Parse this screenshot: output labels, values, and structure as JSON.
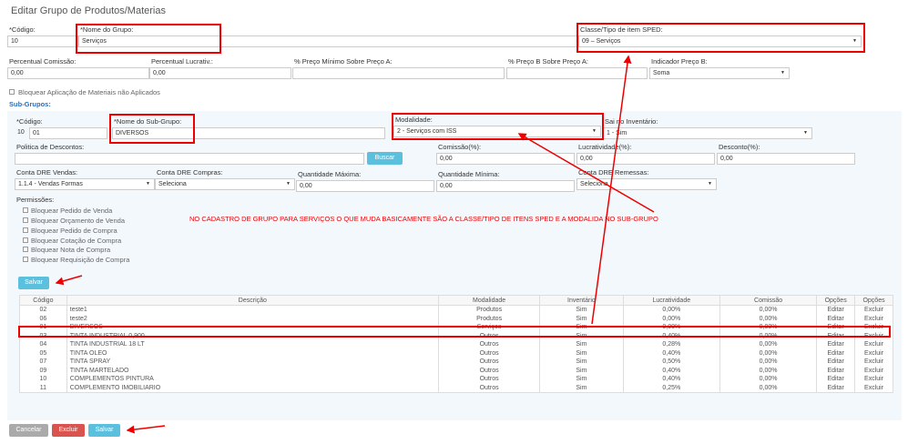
{
  "page": {
    "title": "Editar Grupo de Produtos/Materias"
  },
  "group": {
    "codigo_label": "*Código:",
    "codigo": "10",
    "nome_label": "*Nome do Grupo:",
    "nome": "Serviços",
    "classe_label": "Classe/Tipo de item SPED:",
    "classe": "09 – Serviços",
    "comissao_label": "Percentual Comissão:",
    "comissao": "0,00",
    "lucrativ_label": "Percentual Lucrativ.:",
    "lucrativ": "0,00",
    "precoA_label": "% Preço Mínimo Sobre Preço A:",
    "precoA": "",
    "precoB_label": "% Preço B Sobre Preço A:",
    "precoB": "",
    "indicador_label": "Indicador Preço B:",
    "indicador": "Soma",
    "bloquear_label": "Bloquear Aplicação de Materiais não Aplicados"
  },
  "sub": {
    "section_label": "Sub-Grupos:",
    "codigo_label": "*Código:",
    "codigo_grupo": "10",
    "codigo": "01",
    "nome_label": "*Nome do Sub-Grupo:",
    "nome": "DIVERSOS",
    "modalidade_label": "Modalidade:",
    "modalidade": "2 - Serviços com ISS",
    "inventario_label": "Sai no Inventário:",
    "inventario": "1 - Sim",
    "politica_label": "Politica de Descontos:",
    "politica": "",
    "buscar": "Buscar",
    "comissao_label": "Comissão(%):",
    "comissao": "0,00",
    "lucratividade_label": "Lucratividade(%):",
    "lucratividade": "0,00",
    "desconto_label": "Desconto(%):",
    "desconto": "0,00",
    "dre_vendas_label": "Conta DRE Vendas:",
    "dre_vendas": "1.1.4 - Vendas Formas",
    "dre_compras_label": "Conta DRE Compras:",
    "dre_compras": "Seleciona",
    "qtd_max_label": "Quantidade Máxima:",
    "qtd_max": "0,00",
    "qtd_min_label": "Quantidade Mínima:",
    "qtd_min": "0,00",
    "dre_remessas_label": "Conta DRE Remessas:",
    "dre_remessas": "Seleciona",
    "permissoes_label": "Permissões:",
    "permissoes": [
      "Bloquear Pedido de Venda",
      "Bloquear Orçamento de Venda",
      "Bloquear Pedido de Compra",
      "Bloquear Cotação de Compra",
      "Bloquear Nota de Compra",
      "Bloquear Requisição de Compra"
    ],
    "salvar": "Salvar"
  },
  "annotation": "NO CADASTRO DE GRUPO PARA SERVIÇOS O QUE MUDA BASICAMENTE SÃO A CLASSE/TIPO DE ITENS SPED E A MODALIDA NO SUB-GRUPO",
  "table": {
    "headers": [
      "Código",
      "Descrição",
      "Modalidade",
      "Inventário",
      "Lucratividade",
      "Comissão",
      "Opções",
      "Opções"
    ],
    "rows": [
      [
        "02",
        "teste1",
        "Produtos",
        "Sim",
        "0,00%",
        "0,00%",
        "Editar",
        "Excluir"
      ],
      [
        "06",
        "teste2",
        "Produtos",
        "Sim",
        "0,00%",
        "0,00%",
        "Editar",
        "Excluir"
      ],
      [
        "01",
        "DIVERSOS",
        "Serviços",
        "Sim",
        "0,00%",
        "0,00%",
        "Editar",
        "Excluir"
      ],
      [
        "03",
        "TINTA INDUSTRIAL 0,900",
        "Outros",
        "Sim",
        "0,40%",
        "0,00%",
        "Editar",
        "Excluir"
      ],
      [
        "04",
        "TINTA INDUSTRIAL 18 LT",
        "Outros",
        "Sim",
        "0,28%",
        "0,00%",
        "Editar",
        "Excluir"
      ],
      [
        "05",
        "TINTA OLEO",
        "Outros",
        "Sim",
        "0,40%",
        "0,00%",
        "Editar",
        "Excluir"
      ],
      [
        "07",
        "TINTA SPRAY",
        "Outros",
        "Sim",
        "0,50%",
        "0,00%",
        "Editar",
        "Excluir"
      ],
      [
        "09",
        "TINTA MARTELADO",
        "Outros",
        "Sim",
        "0,40%",
        "0,00%",
        "Editar",
        "Excluir"
      ],
      [
        "10",
        "COMPLEMENTOS PINTURA",
        "Outros",
        "Sim",
        "0,40%",
        "0,00%",
        "Editar",
        "Excluir"
      ],
      [
        "11",
        "COMPLEMENTO IMOBILIARIO",
        "Outros",
        "Sim",
        "0,25%",
        "0,00%",
        "Editar",
        "Excluir"
      ]
    ]
  },
  "footer": {
    "cancelar": "Cancelar",
    "excluir": "Excluir",
    "salvar": "Salvar"
  },
  "colors": {
    "accent": "#5bc0de",
    "danger": "#d9534f",
    "neutral": "#aaaaaa",
    "annotation": "#e00000",
    "link": "#2a6fb7"
  }
}
